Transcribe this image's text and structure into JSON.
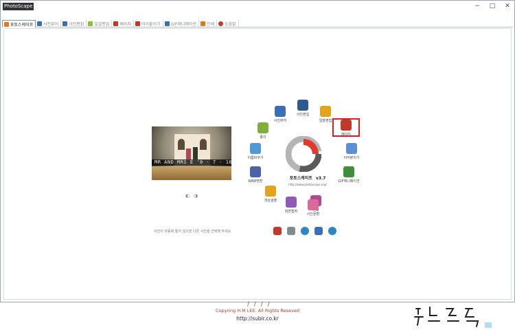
{
  "window": {
    "title": "PhotoScape",
    "minimize": "−",
    "maximize": "□",
    "close": "✕"
  },
  "tabs": [
    {
      "label": "포토스케이프",
      "icon": "photoscape-icon",
      "color": "#d97b1f",
      "active": true
    },
    {
      "label": "사진뷰어",
      "icon": "viewer-icon",
      "color": "#3a6fb5"
    },
    {
      "label": "사진편집",
      "icon": "editor-icon",
      "color": "#3a6fb5"
    },
    {
      "label": "일괄편집",
      "icon": "batch-icon",
      "color": "#8bbf3f"
    },
    {
      "label": "페이지",
      "icon": "page-icon",
      "color": "#c0392b"
    },
    {
      "label": "이어붙이기",
      "icon": "combine-icon",
      "color": "#c0392b"
    },
    {
      "label": "GIF애니메이션",
      "icon": "gif-icon",
      "color": "#3a6fb5"
    },
    {
      "label": "인쇄",
      "icon": "print-icon",
      "color": "#d97b1f"
    },
    {
      "label": "도움말",
      "icon": "help-icon",
      "color": "#c0392b"
    }
  ],
  "photo": {
    "caption": "MR  AND  MRS  E  '0 · 7 · 16"
  },
  "hint": "사진이 마음에 들지 않으면 다른 사진을 선택해 주세요.",
  "brand": {
    "name": "포토스케이프",
    "version": "v3.7",
    "url": "http://www.photoscape.org/"
  },
  "nodes": [
    {
      "label": "사진뷰어",
      "icon": "viewer-icon",
      "color": "#3a6fb5"
    },
    {
      "label": "사진편집",
      "icon": "editor-icon",
      "color": "#2c5c8f"
    },
    {
      "label": "일괄편집",
      "icon": "batch-icon",
      "color": "#e0a51c"
    },
    {
      "label": "페이지",
      "icon": "page-icon",
      "color": "#c0392b"
    },
    {
      "label": "이어붙이기",
      "icon": "combine-icon",
      "color": "#5a8fd4"
    },
    {
      "label": "GIF애니메이션",
      "icon": "gif-icon",
      "color": "#3f8f3a"
    },
    {
      "label": "인쇄",
      "icon": "print-icon",
      "color": "#b04a8f"
    },
    {
      "label": "사진분할",
      "icon": "splitter-icon",
      "color": "#d86a9c"
    },
    {
      "label": "화면캡처",
      "icon": "capture-icon",
      "color": "#8e5bb5"
    },
    {
      "label": "색상검출",
      "icon": "color-picker-icon",
      "color": "#e0a51c"
    },
    {
      "label": "RAW변환",
      "icon": "raw-icon",
      "color": "#4b63a8"
    },
    {
      "label": "이름바꾸기",
      "icon": "rename-icon",
      "color": "#4f9ad6"
    },
    {
      "label": "종이",
      "icon": "paper-icon",
      "color": "#7fae3d"
    }
  ],
  "bottom_tools": [
    {
      "icon": "font-icon",
      "color": "#c0392b"
    },
    {
      "icon": "wrench-icon",
      "color": "#7f8c8d"
    },
    {
      "icon": "refresh-icon",
      "color": "#2e86c1"
    },
    {
      "icon": "brush-icon",
      "color": "#3a6fb5"
    },
    {
      "icon": "sun-icon",
      "color": "#2e86c1"
    }
  ],
  "footer": {
    "slashes": "/ / / /",
    "copyright": "Copyring H.M LEE. All Rights Reseved",
    "url": "http://subir.co.kr"
  }
}
